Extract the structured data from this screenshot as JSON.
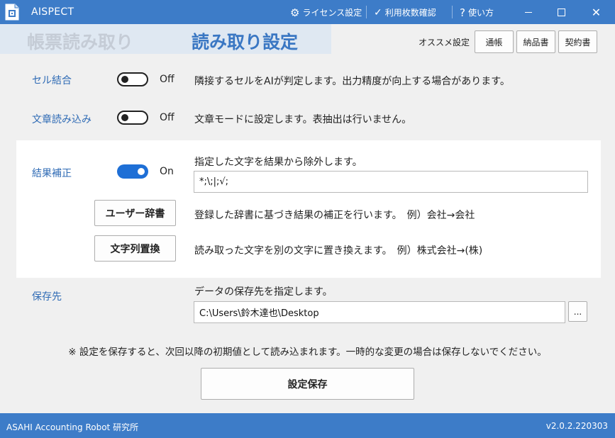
{
  "window": {
    "title": "AISPECT",
    "links": {
      "license": "ライセンス設定",
      "usage": "利用枚数確認",
      "help": "使い方"
    }
  },
  "header": {
    "tab_inactive": "帳票読み取り",
    "tab_active": "読み取り設定",
    "recommend_label": "オススメ設定",
    "presets": [
      "通帳",
      "納品書",
      "契約書"
    ]
  },
  "settings": {
    "cell_merge": {
      "label": "セル結合",
      "state": "Off",
      "description": "隣接するセルをAIが判定します。出力精度が向上する場合があります。"
    },
    "text_read": {
      "label": "文章読み込み",
      "state": "Off",
      "description": "文章モードに設定します。表抽出は行いません。"
    },
    "correction": {
      "label": "結果補正",
      "state": "On",
      "description": "指定した文字を結果から除外します。",
      "exclude_value": "*;\\;|;√;",
      "dict_button": "ユーザー辞書",
      "dict_description": "登録した辞書に基づき結果の補正を行います。　例）会社→会社",
      "replace_button": "文字列置換",
      "replace_description": "読み取った文字を別の文字に置き換えます。　例）株式会社→(株)"
    },
    "save_dest": {
      "label": "保存先",
      "description": "データの保存先を指定します。",
      "path": "C:\\Users\\鈴木達也\\Desktop",
      "browse_label": "..."
    }
  },
  "note": "※ 設定を保存すると、次回以降の初期値として読み込まれます。一時的な変更の場合は保存しないでください。",
  "save_button": "設定保存",
  "status": {
    "left": "ASAHI Accounting Robot 研究所",
    "version": "v2.0.2.220303"
  },
  "colors": {
    "accent": "#3d7cc8",
    "toggle_on": "#1e6fd6",
    "label": "#2f6bb5"
  }
}
